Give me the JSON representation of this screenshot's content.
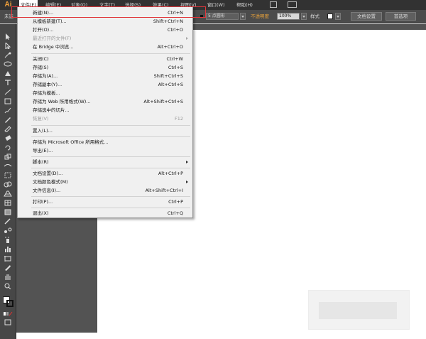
{
  "app": {
    "logo": "Ai"
  },
  "menubar": {
    "items": [
      {
        "label": "文件(F)",
        "active": true
      },
      {
        "label": "编辑(E)"
      },
      {
        "label": "对象(O)"
      },
      {
        "label": "文字(T)"
      },
      {
        "label": "选择(S)"
      },
      {
        "label": "效果(C)"
      },
      {
        "label": "视图(V)"
      },
      {
        "label": "窗口(W)"
      },
      {
        "label": "帮助(H)"
      }
    ]
  },
  "controlbar": {
    "left_label": "未选",
    "stroke_profile": "5 点圆形",
    "opacity_label": "不透明度",
    "opacity_value": "100%",
    "style_label": "样式",
    "doc_setup_button": "文档设置",
    "preferences_button": "首选项"
  },
  "file_menu": {
    "items": [
      {
        "label": "新建(N)...",
        "shortcut": "Ctrl+N"
      },
      {
        "label": "从模板新建(T)...",
        "shortcut": "Shift+Ctrl+N"
      },
      {
        "label": "打开(O)...",
        "shortcut": "Ctrl+O"
      },
      {
        "label": "最近打开的文件(F)",
        "shortcut": "",
        "submenu": true,
        "disabled": true
      },
      {
        "label": "在 Bridge 中浏览...",
        "shortcut": "Alt+Ctrl+O"
      },
      {
        "label": "关闭(C)",
        "shortcut": "Ctrl+W"
      },
      {
        "label": "存储(S)",
        "shortcut": "Ctrl+S"
      },
      {
        "label": "存储为(A)...",
        "shortcut": "Shift+Ctrl+S"
      },
      {
        "label": "存储副本(Y)...",
        "shortcut": "Alt+Ctrl+S"
      },
      {
        "label": "存储为模板...",
        "shortcut": ""
      },
      {
        "label": "存储为 Web 所用格式(W)...",
        "shortcut": "Alt+Shift+Ctrl+S"
      },
      {
        "label": "存储选中的切片...",
        "shortcut": ""
      },
      {
        "label": "恢复(V)",
        "shortcut": "F12",
        "disabled": true
      },
      {
        "label": "置入(L)...",
        "shortcut": ""
      },
      {
        "label": "存储为 Microsoft Office 所用格式...",
        "shortcut": ""
      },
      {
        "label": "导出(E)...",
        "shortcut": ""
      },
      {
        "label": "脚本(R)",
        "shortcut": "",
        "submenu": true
      },
      {
        "label": "文档设置(D)...",
        "shortcut": "Alt+Ctrl+P"
      },
      {
        "label": "文档颜色模式(M)",
        "shortcut": "",
        "submenu": true
      },
      {
        "label": "文件信息(I)...",
        "shortcut": "Alt+Shift+Ctrl+I"
      },
      {
        "label": "打印(P)...",
        "shortcut": "Ctrl+P"
      },
      {
        "label": "退出(X)",
        "shortcut": "Ctrl+Q"
      }
    ]
  },
  "colors": {
    "menubar_bg": "#323232",
    "controlbar_bg": "#4b4b4b",
    "toolbar_bg": "#474747",
    "pasteboard_dark": "#535353",
    "menu_bg": "#f0f0f0",
    "highlight_border": "#e0363b",
    "logo": "#f7a43b",
    "opacity_label": "#e8a13a"
  }
}
